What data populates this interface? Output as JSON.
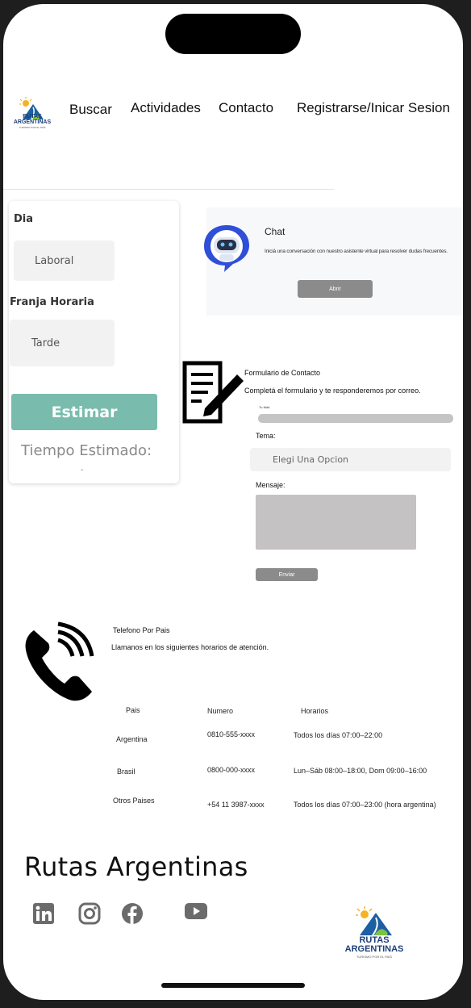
{
  "header": {
    "logo_line1": "RUTAS",
    "logo_line2": "ARGENTINAS",
    "logo_tagline": "TURISMO POR EL PAÍS",
    "nav": [
      "Buscar",
      "Actividades",
      "Contacto",
      "Registrarse/Inicar Sesion"
    ]
  },
  "estimator": {
    "dia_label": "Dia",
    "dia_value": "Laboral",
    "franja_label": "Franja Horaria",
    "franja_value": "Tarde",
    "estimar_button": "Estimar",
    "tiempo_label": "Tiempo Estimado:",
    "tiempo_value": "-"
  },
  "chat": {
    "title": "Chat",
    "description": "Iniciá una conversación con nuestro asistente virtual para resolver dudas frecuentes.",
    "button": "Abrir"
  },
  "contact_form": {
    "title": "Formulario de Contacto",
    "subtitle": "Completá el formulario y te responderemos por correo.",
    "mail_label": "Tu Mail:",
    "tema_label": "Tema:",
    "tema_placeholder": "Elegi Una Opcion",
    "mensaje_label": "Mensaje:",
    "send_button": "Enviar"
  },
  "phones": {
    "title": "Telefono Por Pais",
    "subtitle": "Llamanos en los siguientes horarios de atención.",
    "headers": [
      "Pais",
      "Numero",
      "Horarios"
    ],
    "rows": [
      {
        "pais": "Argentina",
        "numero": "0810-555-xxxx",
        "horario": "Todos los días 07:00–22:00"
      },
      {
        "pais": "Brasil",
        "numero": "0800-000-xxxx",
        "horario": "Lun–Sáb 08:00–18:00, Dom 09:00–16:00"
      },
      {
        "pais": "Otros Paises",
        "numero": "+54 11 3987-xxxx",
        "horario": "Todos los días 07:00–23:00 (hora argentina)"
      }
    ]
  },
  "footer": {
    "brand": "Rutas Argentinas",
    "social": [
      "linkedin-icon",
      "instagram-icon",
      "facebook-icon",
      "youtube-icon"
    ],
    "logo_line1": "RUTAS",
    "logo_line2": "ARGENTINAS",
    "logo_tagline": "TURISMO POR EL PAÍS"
  },
  "colors": {
    "accent": "#79bcad",
    "brand_blue": "#1d5fa3",
    "gray_button": "#8b8b8b"
  }
}
